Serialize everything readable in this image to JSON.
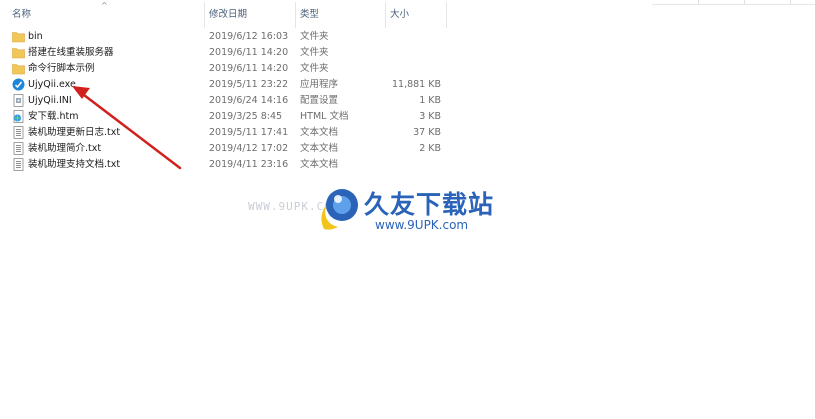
{
  "columns": {
    "name": "名称",
    "date": "修改日期",
    "type": "类型",
    "size": "大小"
  },
  "files": [
    {
      "name": "bin",
      "date": "2019/6/12 16:03",
      "type": "文件夹",
      "size": "",
      "icon": "folder-icon"
    },
    {
      "name": "搭建在线重装服务器",
      "date": "2019/6/11 14:20",
      "type": "文件夹",
      "size": "",
      "icon": "folder-icon"
    },
    {
      "name": "命令行脚本示例",
      "date": "2019/6/11 14:20",
      "type": "文件夹",
      "size": "",
      "icon": "folder-icon"
    },
    {
      "name": "UjyQii.exe",
      "date": "2019/5/11 23:22",
      "type": "应用程序",
      "size": "11,881 KB",
      "icon": "app-icon"
    },
    {
      "name": "UjyQii.INI",
      "date": "2019/6/24 14:16",
      "type": "配置设置",
      "size": "1 KB",
      "icon": "ini-file-icon"
    },
    {
      "name": "安下载.htm",
      "date": "2019/3/25 8:45",
      "type": "HTML 文档",
      "size": "3 KB",
      "icon": "html-file-icon"
    },
    {
      "name": "装机助理更新日志.txt",
      "date": "2019/5/11 17:41",
      "type": "文本文档",
      "size": "37 KB",
      "icon": "text-file-icon"
    },
    {
      "name": "装机助理简介.txt",
      "date": "2019/4/12 17:02",
      "type": "文本文档",
      "size": "2 KB",
      "icon": "text-file-icon"
    },
    {
      "name": "装机助理支持文档.txt",
      "date": "2019/4/11 23:16",
      "type": "文本文档",
      "size": "",
      "icon": "text-file-icon"
    }
  ],
  "watermark": {
    "url_left": "WWW.9UPK.COM",
    "title": "久友下载站",
    "url": "www.9UPK.com"
  },
  "colors": {
    "folder": "#f3c65a",
    "header_text": "#4c607a",
    "arrow": "#d0211c",
    "watermark_blue": "#2a63b8"
  }
}
